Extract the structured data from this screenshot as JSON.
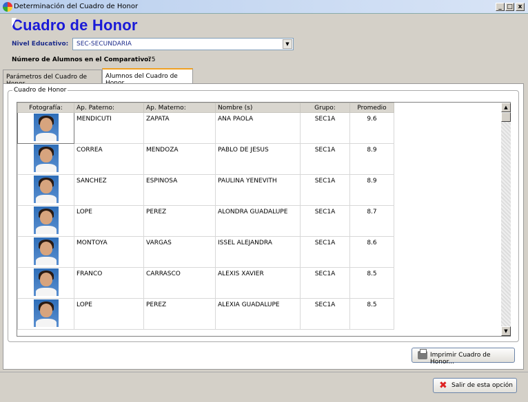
{
  "window": {
    "title": "Determinación del Cuadro de Honor",
    "min": "_",
    "max": "□",
    "close": "x"
  },
  "header": {
    "title": "Cuadro de Honor"
  },
  "form": {
    "nivel_label": "Nivel Educativo:",
    "nivel_value": "SEC-SECUNDARIA",
    "count_label": "Número de Alumnos en el Comparativo:",
    "count_value": "75"
  },
  "tabs": [
    {
      "label": "Parámetros del Cuadro de Honor",
      "active": false
    },
    {
      "label": "Alumnos del Cuadro de Honor",
      "active": true
    }
  ],
  "group_label": "Cuadro de Honor",
  "table": {
    "columns": [
      "Fotografía:",
      "Ap. Paterno:",
      "Ap. Materno:",
      "Nombre (s)",
      "Grupo:",
      "Promedio"
    ],
    "rows": [
      {
        "paterno": "MENDICUTI",
        "materno": "ZAPATA",
        "nombre": "ANA PAOLA",
        "grupo": "SEC1A",
        "promedio": "9.6"
      },
      {
        "paterno": "CORREA",
        "materno": "MENDOZA",
        "nombre": "PABLO DE JESUS",
        "grupo": "SEC1A",
        "promedio": "8.9"
      },
      {
        "paterno": "SANCHEZ",
        "materno": "ESPINOSA",
        "nombre": "PAULINA YENEVITH",
        "grupo": "SEC1A",
        "promedio": "8.9"
      },
      {
        "paterno": "LOPE",
        "materno": "PEREZ",
        "nombre": "ALONDRA GUADALUPE",
        "grupo": "SEC1A",
        "promedio": "8.7"
      },
      {
        "paterno": "MONTOYA",
        "materno": "VARGAS",
        "nombre": "ISSEL ALEJANDRA",
        "grupo": "SEC1A",
        "promedio": "8.6"
      },
      {
        "paterno": "FRANCO",
        "materno": "CARRASCO",
        "nombre": "ALEXIS XAVIER",
        "grupo": "SEC1A",
        "promedio": "8.5"
      },
      {
        "paterno": "LOPE",
        "materno": "PEREZ",
        "nombre": "ALEXIA GUADALUPE",
        "grupo": "SEC1A",
        "promedio": "8.5"
      }
    ]
  },
  "buttons": {
    "print": "Imprimir Cuadro de Honor...",
    "exit": "Salir de esta opción"
  },
  "icons": {
    "print": "printer-icon",
    "exit": "red-x-icon",
    "app": "app-icon"
  }
}
